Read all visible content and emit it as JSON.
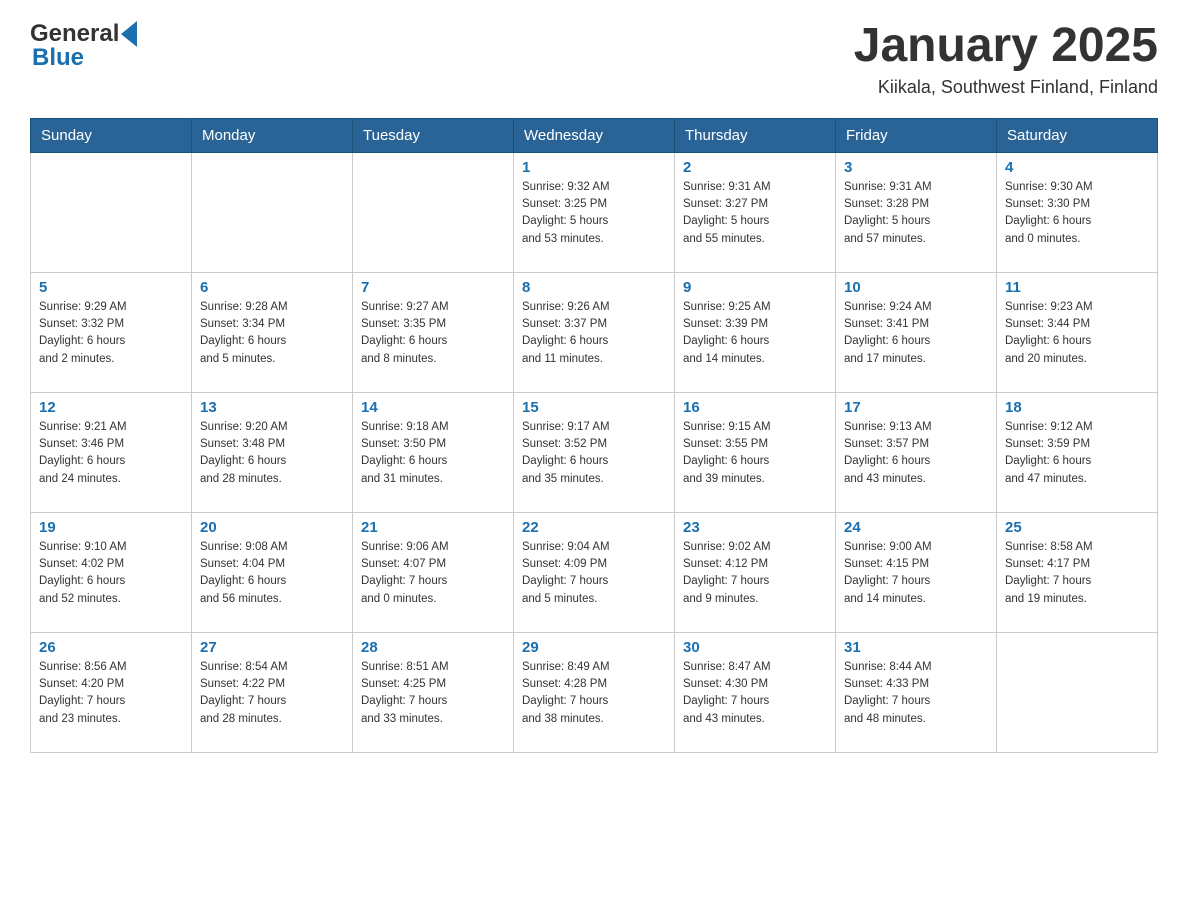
{
  "header": {
    "logo_general": "General",
    "logo_blue": "Blue",
    "title": "January 2025",
    "subtitle": "Kiikala, Southwest Finland, Finland"
  },
  "days_of_week": [
    "Sunday",
    "Monday",
    "Tuesday",
    "Wednesday",
    "Thursday",
    "Friday",
    "Saturday"
  ],
  "weeks": [
    {
      "days": [
        {
          "number": "",
          "info": ""
        },
        {
          "number": "",
          "info": ""
        },
        {
          "number": "",
          "info": ""
        },
        {
          "number": "1",
          "info": "Sunrise: 9:32 AM\nSunset: 3:25 PM\nDaylight: 5 hours\nand 53 minutes."
        },
        {
          "number": "2",
          "info": "Sunrise: 9:31 AM\nSunset: 3:27 PM\nDaylight: 5 hours\nand 55 minutes."
        },
        {
          "number": "3",
          "info": "Sunrise: 9:31 AM\nSunset: 3:28 PM\nDaylight: 5 hours\nand 57 minutes."
        },
        {
          "number": "4",
          "info": "Sunrise: 9:30 AM\nSunset: 3:30 PM\nDaylight: 6 hours\nand 0 minutes."
        }
      ]
    },
    {
      "days": [
        {
          "number": "5",
          "info": "Sunrise: 9:29 AM\nSunset: 3:32 PM\nDaylight: 6 hours\nand 2 minutes."
        },
        {
          "number": "6",
          "info": "Sunrise: 9:28 AM\nSunset: 3:34 PM\nDaylight: 6 hours\nand 5 minutes."
        },
        {
          "number": "7",
          "info": "Sunrise: 9:27 AM\nSunset: 3:35 PM\nDaylight: 6 hours\nand 8 minutes."
        },
        {
          "number": "8",
          "info": "Sunrise: 9:26 AM\nSunset: 3:37 PM\nDaylight: 6 hours\nand 11 minutes."
        },
        {
          "number": "9",
          "info": "Sunrise: 9:25 AM\nSunset: 3:39 PM\nDaylight: 6 hours\nand 14 minutes."
        },
        {
          "number": "10",
          "info": "Sunrise: 9:24 AM\nSunset: 3:41 PM\nDaylight: 6 hours\nand 17 minutes."
        },
        {
          "number": "11",
          "info": "Sunrise: 9:23 AM\nSunset: 3:44 PM\nDaylight: 6 hours\nand 20 minutes."
        }
      ]
    },
    {
      "days": [
        {
          "number": "12",
          "info": "Sunrise: 9:21 AM\nSunset: 3:46 PM\nDaylight: 6 hours\nand 24 minutes."
        },
        {
          "number": "13",
          "info": "Sunrise: 9:20 AM\nSunset: 3:48 PM\nDaylight: 6 hours\nand 28 minutes."
        },
        {
          "number": "14",
          "info": "Sunrise: 9:18 AM\nSunset: 3:50 PM\nDaylight: 6 hours\nand 31 minutes."
        },
        {
          "number": "15",
          "info": "Sunrise: 9:17 AM\nSunset: 3:52 PM\nDaylight: 6 hours\nand 35 minutes."
        },
        {
          "number": "16",
          "info": "Sunrise: 9:15 AM\nSunset: 3:55 PM\nDaylight: 6 hours\nand 39 minutes."
        },
        {
          "number": "17",
          "info": "Sunrise: 9:13 AM\nSunset: 3:57 PM\nDaylight: 6 hours\nand 43 minutes."
        },
        {
          "number": "18",
          "info": "Sunrise: 9:12 AM\nSunset: 3:59 PM\nDaylight: 6 hours\nand 47 minutes."
        }
      ]
    },
    {
      "days": [
        {
          "number": "19",
          "info": "Sunrise: 9:10 AM\nSunset: 4:02 PM\nDaylight: 6 hours\nand 52 minutes."
        },
        {
          "number": "20",
          "info": "Sunrise: 9:08 AM\nSunset: 4:04 PM\nDaylight: 6 hours\nand 56 minutes."
        },
        {
          "number": "21",
          "info": "Sunrise: 9:06 AM\nSunset: 4:07 PM\nDaylight: 7 hours\nand 0 minutes."
        },
        {
          "number": "22",
          "info": "Sunrise: 9:04 AM\nSunset: 4:09 PM\nDaylight: 7 hours\nand 5 minutes."
        },
        {
          "number": "23",
          "info": "Sunrise: 9:02 AM\nSunset: 4:12 PM\nDaylight: 7 hours\nand 9 minutes."
        },
        {
          "number": "24",
          "info": "Sunrise: 9:00 AM\nSunset: 4:15 PM\nDaylight: 7 hours\nand 14 minutes."
        },
        {
          "number": "25",
          "info": "Sunrise: 8:58 AM\nSunset: 4:17 PM\nDaylight: 7 hours\nand 19 minutes."
        }
      ]
    },
    {
      "days": [
        {
          "number": "26",
          "info": "Sunrise: 8:56 AM\nSunset: 4:20 PM\nDaylight: 7 hours\nand 23 minutes."
        },
        {
          "number": "27",
          "info": "Sunrise: 8:54 AM\nSunset: 4:22 PM\nDaylight: 7 hours\nand 28 minutes."
        },
        {
          "number": "28",
          "info": "Sunrise: 8:51 AM\nSunset: 4:25 PM\nDaylight: 7 hours\nand 33 minutes."
        },
        {
          "number": "29",
          "info": "Sunrise: 8:49 AM\nSunset: 4:28 PM\nDaylight: 7 hours\nand 38 minutes."
        },
        {
          "number": "30",
          "info": "Sunrise: 8:47 AM\nSunset: 4:30 PM\nDaylight: 7 hours\nand 43 minutes."
        },
        {
          "number": "31",
          "info": "Sunrise: 8:44 AM\nSunset: 4:33 PM\nDaylight: 7 hours\nand 48 minutes."
        },
        {
          "number": "",
          "info": ""
        }
      ]
    }
  ]
}
